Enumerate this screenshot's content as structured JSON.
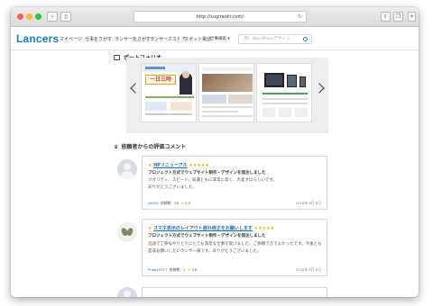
{
  "browser": {
    "url": "http://sugiraoki.com/",
    "reload_icon": "↻ reload-icon"
  },
  "nav": {
    "logo": "Lancers",
    "links": [
      "マイページ",
      "仕事をさがす",
      "ランサーをさがす",
      "ランサーズストア",
      "スポット電話"
    ],
    "dropdown_label": "仕事検索 ▾",
    "search_placeholder": "例：WordPressデザイン"
  },
  "portfolio": {
    "heading": "ポートフォリオ",
    "thumb1_banner": "一日三時"
  },
  "reviews": {
    "heading": "依頼者からの評価コメント",
    "items": [
      {
        "title": "HPリニューアル",
        "stars": "★★★★★",
        "subtitle": "プロジェクト方式でウェブサイト制作・デザインを発注しました",
        "body": "クオリティ、スピード、知識ともに非常に高く、大変すばらしいです。\nありがとうございました。",
        "user": "s0000",
        "meta": "依頼数：26",
        "rating_star": "★",
        "rating": "5.0",
        "date": "2016年 6月 8日"
      },
      {
        "title": "スマホ表示のレイアウト崩れ修正をお願いします",
        "stars": "★★★★★",
        "subtitle": "プロジェクト方式でウェブサイト制作・デザインを発注しました",
        "body": "迅速で丁寧なやりとりにとても満足な仕事を受けました。ご依頼できてよかったです。今後とも\n是非お願いしたいランサー様です。ありがとうございました。",
        "user": "Puppy5717",
        "meta": "依頼数：1",
        "rating_star": "★",
        "rating": "4.8",
        "date": "2016年 6月 6日"
      }
    ]
  },
  "colors": {
    "brand": "#1e7fc8",
    "star": "#f0b400",
    "link": "#1e6fbf"
  }
}
